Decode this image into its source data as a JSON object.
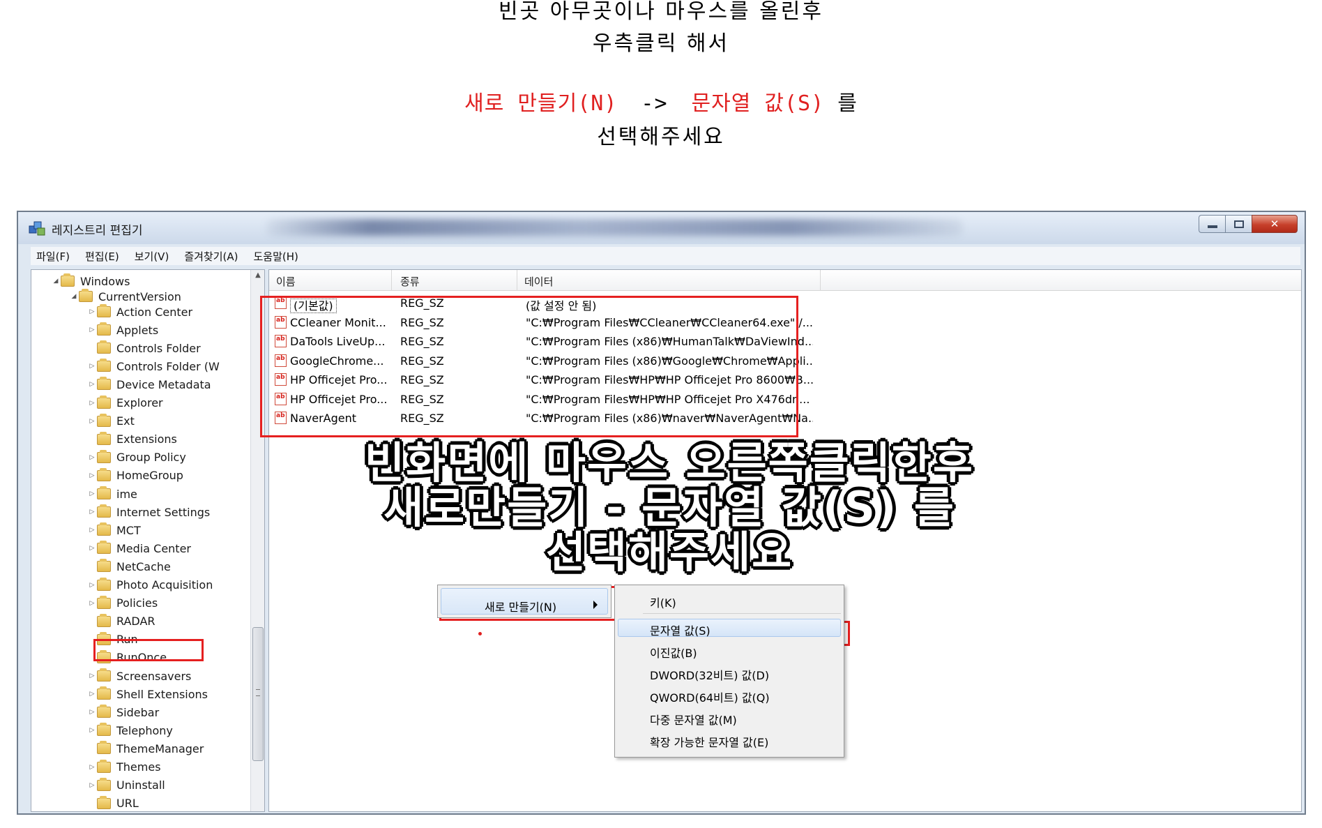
{
  "instructions": {
    "line1": "빈곳 아무곳이나 마우스를 올린후",
    "line2": "우측클릭 해서",
    "line3_part1": "새로 만들기(N)",
    "line3_arrow": "->",
    "line3_part2": "문자열 값(S)",
    "line3_part3": "를",
    "line4": "선택해주세요",
    "highlight_color": "#e02020"
  },
  "window": {
    "title": "레지스트리 편집기",
    "icon": "regedit-icon",
    "controls": [
      "minimize",
      "maximize",
      "close"
    ]
  },
  "menubar": [
    "파일(F)",
    "편집(E)",
    "보기(V)",
    "즐겨찾기(A)",
    "도움말(H)"
  ],
  "tree": {
    "windows": "Windows",
    "current_version": "CurrentVersion",
    "children": [
      "Action Center",
      "Applets",
      "Controls Folder",
      "Controls Folder (W",
      "Device Metadata",
      "Explorer",
      "Ext",
      "Extensions",
      "Group Policy",
      "HomeGroup",
      "ime",
      "Internet Settings",
      "MCT",
      "Media Center",
      "NetCache",
      "Photo Acquisition",
      "Policies",
      "RADAR",
      "Run",
      "RunOnce",
      "Screensavers",
      "Shell Extensions",
      "Sidebar",
      "Telephony",
      "ThemeManager",
      "Themes",
      "Uninstall",
      "URL"
    ],
    "selected": "Run"
  },
  "list": {
    "columns": [
      "이름",
      "종류",
      "데이터"
    ],
    "rows": [
      {
        "name": "(기본값)",
        "type": "REG_SZ",
        "data": "(값 설정 안 됨)"
      },
      {
        "name": "CCleaner Monit...",
        "type": "REG_SZ",
        "data": "\"C:₩Program Files₩CCleaner₩CCleaner64.exe\" /..."
      },
      {
        "name": "DaTools LiveUp...",
        "type": "REG_SZ",
        "data": "\"C:₩Program Files (x86)₩HumanTalk₩DaViewInd..."
      },
      {
        "name": "GoogleChrome...",
        "type": "REG_SZ",
        "data": "\"C:₩Program Files (x86)₩Google₩Chrome₩Appli..."
      },
      {
        "name": "HP Officejet Pro...",
        "type": "REG_SZ",
        "data": "\"C:₩Program Files₩HP₩HP Officejet Pro 8600₩B..."
      },
      {
        "name": "HP Officejet Pro...",
        "type": "REG_SZ",
        "data": "\"C:₩Program Files₩HP₩HP Officejet Pro X476dn..."
      },
      {
        "name": "NaverAgent",
        "type": "REG_SZ",
        "data": "\"C:₩Program Files (x86)₩naver₩NaverAgent₩Na..."
      }
    ],
    "value_icon_text": "ab"
  },
  "overlay": {
    "line1": "빈화면에 마우스 오른쪽클릭한후",
    "line2": "새로만들기 - 문자열 값(S) 를",
    "line3": "선택해주세요"
  },
  "context_menu": {
    "new_item": "새로 만들기(N)",
    "submenu": [
      "키(K)",
      "문자열 값(S)",
      "이진값(B)",
      "DWORD(32비트) 값(D)",
      "QWORD(64비트) 값(Q)",
      "다중 문자열 값(M)",
      "확장 가능한 문자열 값(E)"
    ],
    "highlighted": "문자열 값(S)"
  }
}
